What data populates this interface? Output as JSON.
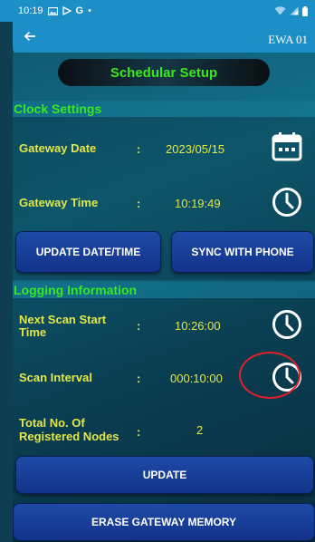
{
  "status_bar": {
    "time": "10:19",
    "indicator_icons": [
      "gallery-icon",
      "play-icon",
      "google-icon",
      "dot-icon"
    ],
    "system_icons": [
      "wifi-icon",
      "signal-icon",
      "battery-icon"
    ]
  },
  "app_bar": {
    "back_icon": "arrow-left-icon",
    "device_name": "EWA 01"
  },
  "page_title": "Schedular Setup",
  "clock_settings": {
    "header": "Clock Settings",
    "date_label": "Gateway Date",
    "date_colon": ":",
    "date_value": "2023/05/15",
    "date_icon": "calendar-icon",
    "time_label": "Gateway Time",
    "time_colon": ":",
    "time_value": "10:19:49",
    "time_icon": "clock-icon",
    "update_button": "UPDATE DATE/TIME",
    "sync_button": "SYNC WITH PHONE"
  },
  "logging_information": {
    "header": "Logging Information",
    "next_scan_label_line1": "Next Scan Start",
    "next_scan_label_line2": "Time",
    "next_scan_colon": ":",
    "next_scan_value": "10:26:00",
    "next_scan_icon": "clock-icon",
    "interval_label": "Scan Interval",
    "interval_colon": ":",
    "interval_value": "000:10:00",
    "interval_icon": "clock-icon",
    "nodes_label_line1": "Total No. Of",
    "nodes_label_line2": "Registered Nodes",
    "nodes_colon": ":",
    "nodes_value": "2",
    "update_button": "UPDATE",
    "erase_button": "ERASE GATEWAY MEMORY"
  },
  "colors": {
    "status_bar": "#1c8fc6",
    "title_text": "#39e81e",
    "label_text": "#e3e84a",
    "button": "#1a3f9a",
    "annotation": "#e0202a"
  }
}
